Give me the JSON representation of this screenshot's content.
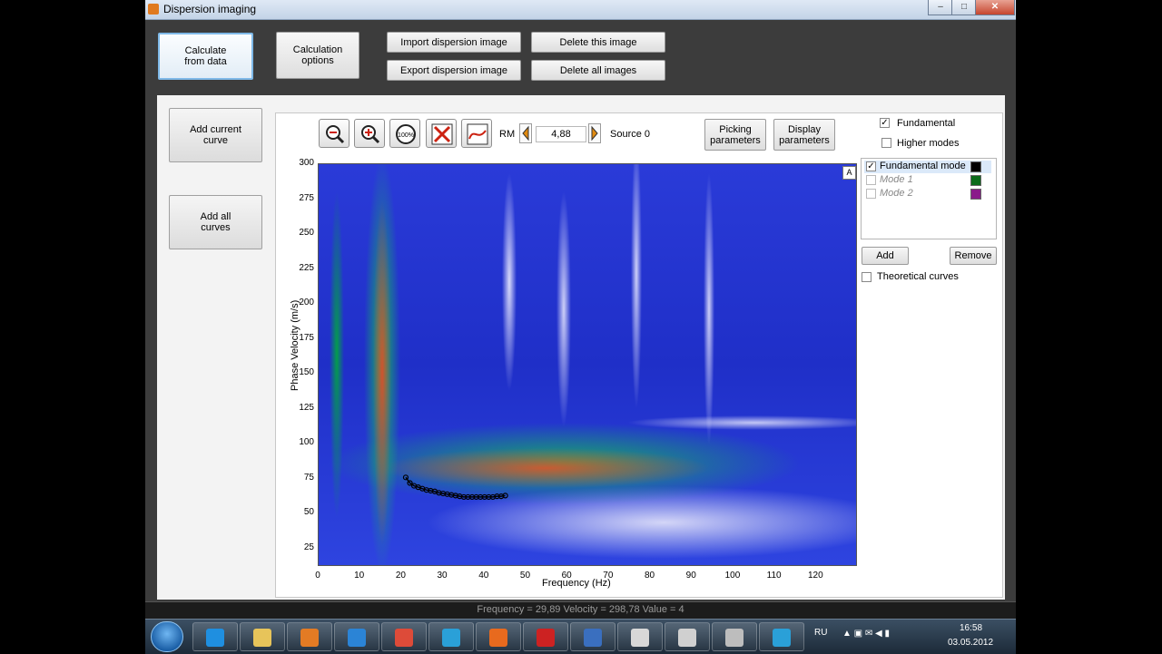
{
  "window": {
    "title": "Dispersion imaging",
    "min": "–",
    "max": "□",
    "close": "✕"
  },
  "toolbar": {
    "calc_from_data": "Calculate\nfrom data",
    "calc_options": "Calculation\noptions",
    "import_image": "Import dispersion image",
    "export_image": "Export dispersion image",
    "delete_image": "Delete this image",
    "delete_all": "Delete all images"
  },
  "left": {
    "add_current": "Add current\ncurve",
    "add_all": "Add all\ncurves"
  },
  "chart_controls": {
    "rm_label": "RM",
    "rm_value": "4,88",
    "source_label": "Source 0",
    "picking_params": "Picking\nparameters",
    "display_params": "Display\nparameters",
    "zoom_100": "100%"
  },
  "options": {
    "fundamental": "Fundamental",
    "fundamental_checked": true,
    "higher_modes": "Higher modes",
    "higher_checked": false,
    "modes": [
      {
        "name": "Fundamental mode",
        "color": "#000000",
        "checked": true
      },
      {
        "name": "Mode 1",
        "color": "#0b6b1a",
        "checked": false
      },
      {
        "name": "Mode 2",
        "color": "#8a1a8a",
        "checked": false
      }
    ],
    "add": "Add",
    "remove": "Remove",
    "theoretical": "Theoretical curves"
  },
  "chart_data": {
    "type": "heatmap",
    "xlabel": "Frequency (Hz)",
    "ylabel": "Phase Velocity (m/s)",
    "xlim": [
      0,
      130
    ],
    "ylim": [
      12,
      300
    ],
    "x_ticks": [
      0,
      10,
      20,
      30,
      40,
      50,
      60,
      70,
      80,
      90,
      100,
      110,
      120
    ],
    "y_ticks": [
      25,
      50,
      75,
      100,
      125,
      150,
      175,
      200,
      225,
      250,
      275,
      300
    ],
    "corner_tag": "A",
    "picked_curve": {
      "name": "Fundamental mode",
      "x": [
        21,
        22,
        23,
        24,
        25,
        26,
        27,
        28,
        29,
        30,
        31,
        32,
        33,
        34,
        35,
        36,
        37,
        38,
        39,
        40,
        41,
        42,
        43,
        44,
        45
      ],
      "y": [
        76,
        72,
        70,
        69,
        68,
        67,
        66.5,
        66,
        65,
        64.5,
        64,
        63.5,
        63,
        62.5,
        62,
        62,
        62,
        62,
        62,
        62,
        62,
        62,
        62.5,
        62.5,
        63
      ]
    }
  },
  "status": "Frequency = 29,89 Velocity = 298,78 Value = 4",
  "taskbar": {
    "lang": "RU",
    "time": "16:58",
    "date": "03.05.2012",
    "apps": [
      "#1f8fe0",
      "#e7c45a",
      "#e37b24",
      "#2b84d6",
      "#dd4b39",
      "#2aa0d8",
      "#e86a1e",
      "#cc2222",
      "#3a6fbf",
      "#d8d8d8",
      "#d0d0d0",
      "#bdbdbd",
      "#2aa0d8"
    ]
  }
}
